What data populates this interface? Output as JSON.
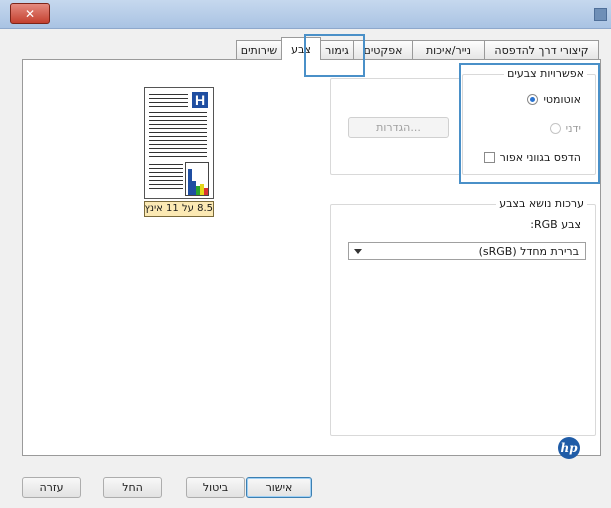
{
  "window": {
    "title": "",
    "close_glyph": "✕"
  },
  "tabs": [
    {
      "label": "קיצורי דרך להדפסה",
      "active": false
    },
    {
      "label": "נייר/איכות",
      "active": false
    },
    {
      "label": "אפקטים",
      "active": false
    },
    {
      "label": "גימור",
      "active": false
    },
    {
      "label": "צבע",
      "active": true
    },
    {
      "label": "שירותים",
      "active": false
    }
  ],
  "preview": {
    "logo_letter": "H",
    "paper_size": "8.5 על 11 אינץ'",
    "bar_colors": [
      "#1f4ea1",
      "#1f4ea1",
      "#2aa52a",
      "#e4d71a",
      "#d93232"
    ]
  },
  "color_options": {
    "title": "אפשרויות צבעים",
    "automatic_label": "אוטומטי",
    "manual_label": "ידני",
    "settings_button": "הגדרות...",
    "grayscale_label": "הדפס בגווני אפור",
    "selected": "automatic"
  },
  "color_themes": {
    "title": "ערכות נושא בצבע",
    "rgb_label": "צבע RGB:",
    "selected_value": "ברירת מחדל (sRGB)"
  },
  "logo": {
    "text": "hp"
  },
  "buttons": {
    "ok": "אישור",
    "cancel": "ביטול",
    "apply": "החל",
    "help": "עזרה"
  },
  "colors": {
    "accent": "#4a90c8",
    "hp_blue": "#1f5ca7"
  }
}
